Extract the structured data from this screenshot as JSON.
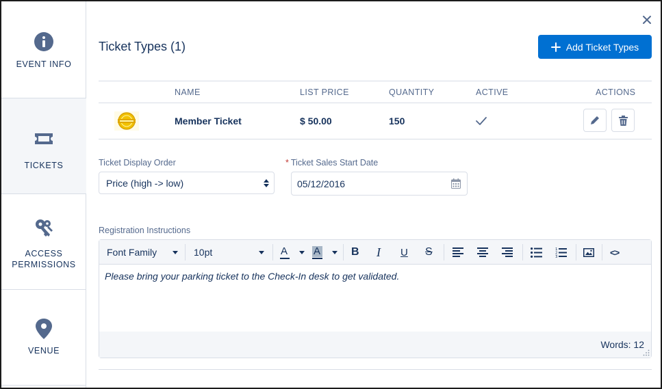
{
  "sidebar": {
    "items": [
      {
        "label": "EVENT INFO",
        "icon": "info-icon"
      },
      {
        "label": "TICKETS",
        "icon": "ticket-icon"
      },
      {
        "label": "ACCESS PERMISSIONS",
        "line1": "ACCESS",
        "line2": "PERMISSIONS",
        "icon": "key-icon"
      },
      {
        "label": "VENUE",
        "icon": "location-pin-icon"
      }
    ],
    "active_index": 1
  },
  "header": {
    "title": "Ticket Types (1)",
    "add_button_label": "Add Ticket Types"
  },
  "table": {
    "columns": [
      "NAME",
      "LIST PRICE",
      "QUANTITY",
      "ACTIVE",
      "ACTIONS"
    ],
    "rows": [
      {
        "image_icon": "member-badge-icon",
        "name": "Member Ticket",
        "list_price": "$ 50.00",
        "quantity": "150",
        "active": true
      }
    ]
  },
  "form": {
    "display_order_label": "Ticket Display Order",
    "display_order_value": "Price (high -> low)",
    "sales_start_label": "Ticket Sales Start Date",
    "sales_start_required": "*",
    "sales_start_value": "05/12/2016"
  },
  "editor": {
    "label": "Registration Instructions",
    "font_family": "Font Family",
    "font_size": "10pt",
    "text_color_glyph": "A",
    "bg_color_glyph": "A",
    "bold_glyph": "B",
    "italic_glyph": "I",
    "underline_glyph": "U",
    "strike_glyph": "S",
    "code_glyph": "<>",
    "content": "Please bring your parking ticket to the Check-In desk to get validated.",
    "word_count": "Words: 12"
  },
  "colors": {
    "brand_blue": "#0070d2",
    "text_primary": "#16325c",
    "text_secondary": "#54698d",
    "border": "#d8dde6",
    "icon_gray": "#54698d",
    "required": "#c23934"
  }
}
